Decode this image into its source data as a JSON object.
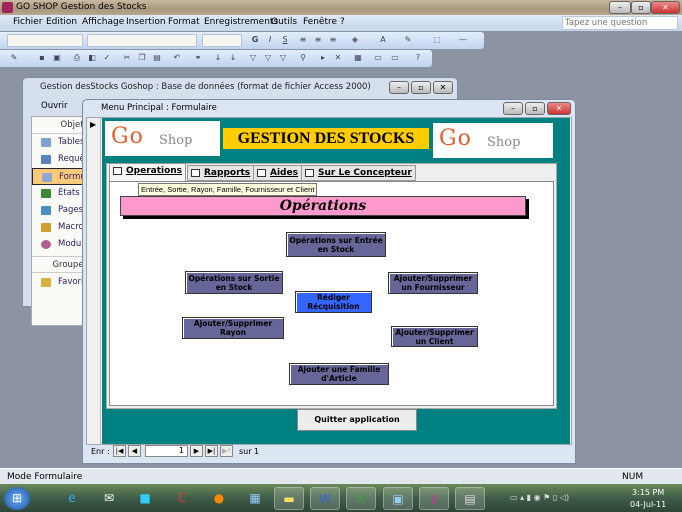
{
  "app": {
    "title": "GO SHOP Gestion des Stocks",
    "help_placeholder": "Tapez une question"
  },
  "menu": [
    "Fichier",
    "Edition",
    "Affichage",
    "Insertion",
    "Format",
    "Enregistrements",
    "Outils",
    "Fenêtre",
    "?"
  ],
  "db_window": {
    "title": "Gestion desStocks Goshop : Base de données (format de fichier Access 2000)",
    "open_label": "Ouvrir",
    "objects_header": "Objets",
    "items": [
      "Tables",
      "Requêtes",
      "Formulaires",
      "États",
      "Pages",
      "Macros",
      "Modules"
    ],
    "selected": "Formulaires",
    "groups_header": "Groupes",
    "favorites": "Favoris"
  },
  "form": {
    "title": "Menu Principal : Formulaire",
    "logo_text": "GoShop",
    "heading": "GESTION DES STOCKS",
    "tabs": [
      "Operations",
      "Rapports",
      "Aides",
      "Sur Le Concepteur"
    ],
    "active_tab": "Operations",
    "tooltip": "Entrée, Sortie, Rayon, Famille, Fournisseur et Client",
    "banner": "Opérations",
    "buttons": {
      "entree": "Opérations sur Entrée en Stock",
      "sortie": "Opérations sur Sortie en Stock",
      "requisition": "Rédiger Récquisition",
      "fournisseur": "Ajouter/Supprimer un Fournisseur",
      "rayon": "Ajouter/Supprimer Rayon",
      "client": "Ajouter/Supprimer un Client",
      "famille": "Ajouter une Famille d'Article"
    },
    "quit": "Quitter application",
    "nav": {
      "label": "Enr :",
      "current": "1",
      "of": "sur",
      "total": "1"
    }
  },
  "status": {
    "mode": "Mode Formulaire",
    "num": "NUM"
  },
  "clock": {
    "time": "3:15 PM",
    "date": "04-Jul-11"
  },
  "colors": {
    "teal": "#008080",
    "gold": "#ffcc00",
    "pink": "#ff99cc",
    "button": "#666699",
    "button_active": "#3366ff"
  }
}
